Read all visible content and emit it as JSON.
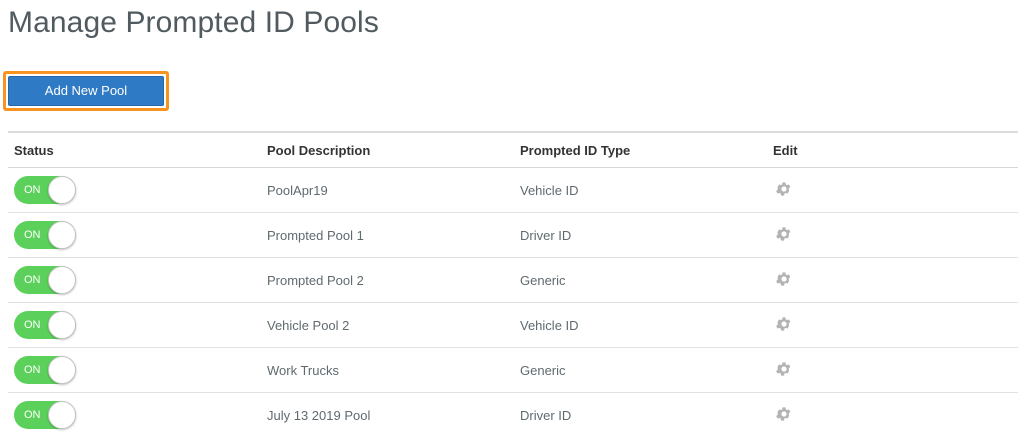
{
  "page": {
    "title": "Manage Prompted ID Pools"
  },
  "toolbar": {
    "add_label": "Add New Pool"
  },
  "table": {
    "headers": {
      "status": "Status",
      "description": "Pool Description",
      "type": "Prompted ID Type",
      "edit": "Edit"
    },
    "rows": [
      {
        "status": "ON",
        "description": "PoolApr19",
        "type": "Vehicle ID"
      },
      {
        "status": "ON",
        "description": "Prompted Pool 1",
        "type": "Driver ID"
      },
      {
        "status": "ON",
        "description": "Prompted Pool 2",
        "type": "Generic"
      },
      {
        "status": "ON",
        "description": "Vehicle Pool 2",
        "type": "Vehicle ID"
      },
      {
        "status": "ON",
        "description": "Work Trucks",
        "type": "Generic"
      },
      {
        "status": "ON",
        "description": "July 13 2019 Pool",
        "type": "Driver ID"
      }
    ]
  },
  "icons": {
    "edit": "gear-icon"
  },
  "colors": {
    "accent": "#2f7ac4",
    "focus": "#f7931e",
    "toggle_on": "#5bd15b",
    "gear": "#b3b3b3"
  }
}
